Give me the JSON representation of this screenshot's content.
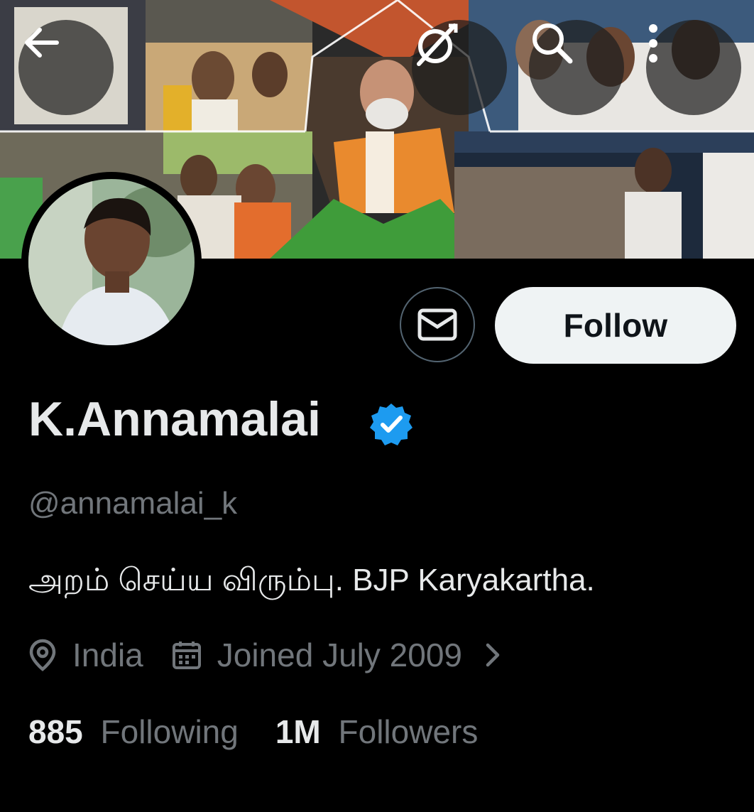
{
  "profile": {
    "display_name": "K.Annamalai",
    "handle": "@annamalai_k",
    "bio": "அறம் செய்ய விரும்பு. BJP Karyakartha.",
    "location": "India",
    "joined": "Joined July 2009"
  },
  "stats": {
    "following_count": "885",
    "following_label": "Following",
    "followers_count": "1M",
    "followers_label": "Followers"
  },
  "actions": {
    "follow_label": "Follow"
  },
  "icons": {
    "back": "arrow-left-icon",
    "grok": "grok-icon",
    "search": "search-icon",
    "more": "more-vertical-icon",
    "message": "envelope-icon",
    "verified": "verified-badge-icon",
    "location": "location-pin-icon",
    "calendar": "calendar-icon",
    "chevron": "chevron-right-icon"
  },
  "colors": {
    "background": "#000000",
    "follow_bg": "#eff3f4",
    "verified": "#1d9bf0",
    "muted_text": "#71767b"
  }
}
